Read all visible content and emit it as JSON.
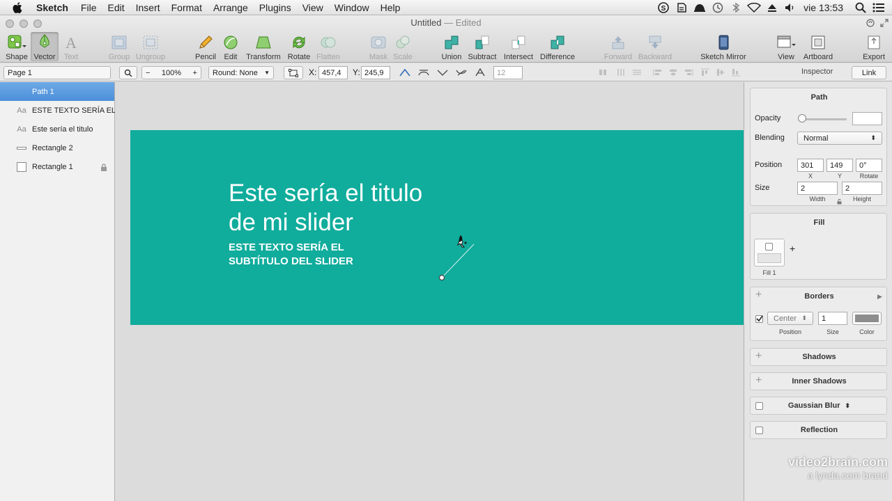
{
  "menubar": {
    "app_name": "Sketch",
    "items": [
      "File",
      "Edit",
      "Insert",
      "Format",
      "Arrange",
      "Plugins",
      "View",
      "Window",
      "Help"
    ],
    "clock": "vie 13:53"
  },
  "window": {
    "title": "Untitled",
    "edited": "— Edited"
  },
  "toolbar": {
    "tools": [
      {
        "label": "Shape",
        "icon": "shape-icon"
      },
      {
        "label": "Vector",
        "icon": "vector-pen-icon"
      },
      {
        "label": "Text",
        "icon": "text-icon"
      },
      {
        "label": "Group",
        "icon": "group-icon"
      },
      {
        "label": "Ungroup",
        "icon": "ungroup-icon"
      },
      {
        "label": "Pencil",
        "icon": "pencil-icon"
      },
      {
        "label": "Edit",
        "icon": "edit-icon"
      },
      {
        "label": "Transform",
        "icon": "transform-icon"
      },
      {
        "label": "Rotate",
        "icon": "rotate-icon"
      },
      {
        "label": "Flatten",
        "icon": "flatten-icon"
      },
      {
        "label": "Mask",
        "icon": "mask-icon"
      },
      {
        "label": "Scale",
        "icon": "scale-icon"
      },
      {
        "label": "Union",
        "icon": "union-icon"
      },
      {
        "label": "Subtract",
        "icon": "subtract-icon"
      },
      {
        "label": "Intersect",
        "icon": "intersect-icon"
      },
      {
        "label": "Difference",
        "icon": "difference-icon"
      },
      {
        "label": "Forward",
        "icon": "forward-icon"
      },
      {
        "label": "Backward",
        "icon": "backward-icon"
      },
      {
        "label": "Sketch Mirror",
        "icon": "sketch-mirror-icon"
      },
      {
        "label": "View",
        "icon": "view-icon"
      },
      {
        "label": "Artboard",
        "icon": "artboard-icon"
      },
      {
        "label": "Export",
        "icon": "export-icon"
      }
    ]
  },
  "options": {
    "page": "Page 1",
    "zoom": "100%",
    "round": "Round: None",
    "x_label": "X:",
    "x_value": "457,4",
    "y_label": "Y:",
    "y_value": "245,9",
    "radius_value": "12",
    "inspector": "Inspector",
    "link": "Link"
  },
  "layers": [
    {
      "name": "Path 1",
      "icon": "path-icon",
      "selected": true
    },
    {
      "name": "ESTE TEXTO SERÍA EL",
      "icon": "text-layer-icon"
    },
    {
      "name": "Este sería el titulo",
      "icon": "text-layer-icon"
    },
    {
      "name": "Rectangle 2",
      "icon": "rectangle-icon"
    },
    {
      "name": "Rectangle 1",
      "icon": "rectangle-icon",
      "locked": true
    }
  ],
  "canvas": {
    "slide_title": "Este sería el titulo de mi slider",
    "slide_subtitle": "ESTE TEXTO SERÍA EL SUBTÍTULO DEL SLIDER",
    "artboard_color": "#10ac9c"
  },
  "inspector": {
    "path_title": "Path",
    "opacity_label": "Opacity",
    "blending_label": "Blending",
    "blending_value": "Normal",
    "position_label": "Position",
    "pos_x": "301",
    "pos_y": "149",
    "rotate": "0°",
    "x_sub": "X",
    "y_sub": "Y",
    "rotate_sub": "Rotate",
    "size_label": "Size",
    "width": "2",
    "height": "2",
    "width_sub": "Width",
    "height_sub": "Height",
    "fill_title": "Fill",
    "fill_label": "Fill 1",
    "fill_add": "+",
    "borders_title": "Borders",
    "border_position": "Center",
    "border_size": "1",
    "border_position_sub": "Position",
    "border_size_sub": "Size",
    "border_color_sub": "Color",
    "shadows_title": "Shadows",
    "inner_shadows_title": "Inner Shadows",
    "gaussian_blur_title": "Gaussian Blur",
    "reflection_title": "Reflection"
  },
  "watermark": {
    "line1": "video2brain.com",
    "line2": "a lynda.com brand"
  }
}
